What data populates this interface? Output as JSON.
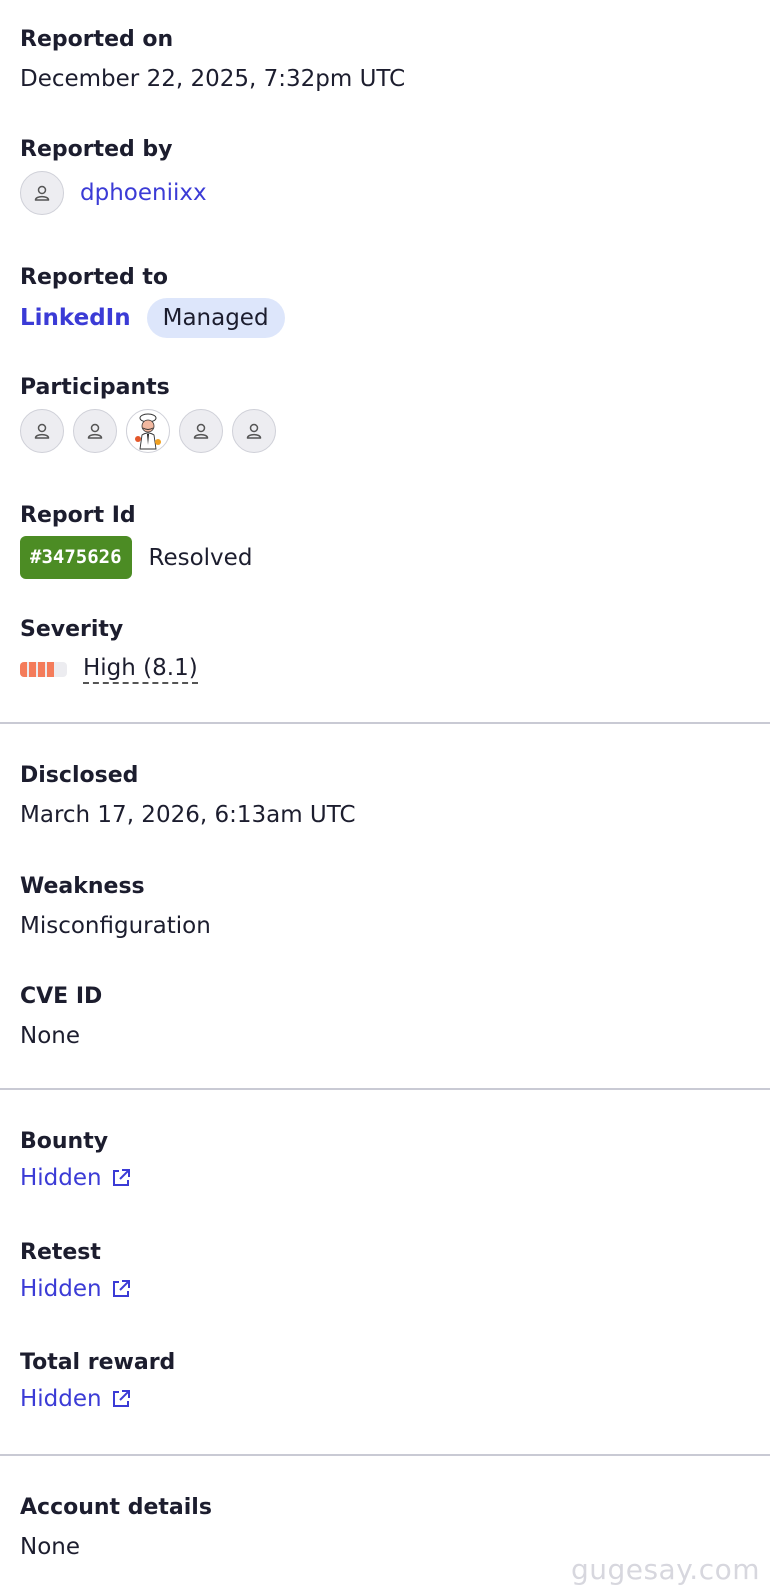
{
  "reported_on": {
    "label": "Reported on",
    "value": "December 22, 2025, 7:32pm UTC"
  },
  "reported_by": {
    "label": "Reported by",
    "username": "dphoeniixx"
  },
  "reported_to": {
    "label": "Reported to",
    "program": "LinkedIn",
    "badge": "Managed"
  },
  "participants": {
    "label": "Participants",
    "count": 5
  },
  "report_id": {
    "label": "Report Id",
    "id": "#3475626",
    "status": "Resolved"
  },
  "severity": {
    "label": "Severity",
    "text": "High (8.1)",
    "score": 8.1,
    "segments_filled": 4,
    "color": "#f47c5b"
  },
  "disclosed": {
    "label": "Disclosed",
    "value": "March 17, 2026, 6:13am UTC"
  },
  "weakness": {
    "label": "Weakness",
    "value": "Misconfiguration"
  },
  "cve": {
    "label": "CVE ID",
    "value": "None"
  },
  "bounty": {
    "label": "Bounty",
    "value": "Hidden"
  },
  "retest": {
    "label": "Retest",
    "value": "Hidden"
  },
  "total_reward": {
    "label": "Total reward",
    "value": "Hidden"
  },
  "account_details": {
    "label": "Account details",
    "value": "None"
  },
  "watermark": "gugesay.com",
  "colors": {
    "link": "#3b3bd6",
    "id_badge": "#4c8c24",
    "managed_pill": "#dde6fb"
  }
}
